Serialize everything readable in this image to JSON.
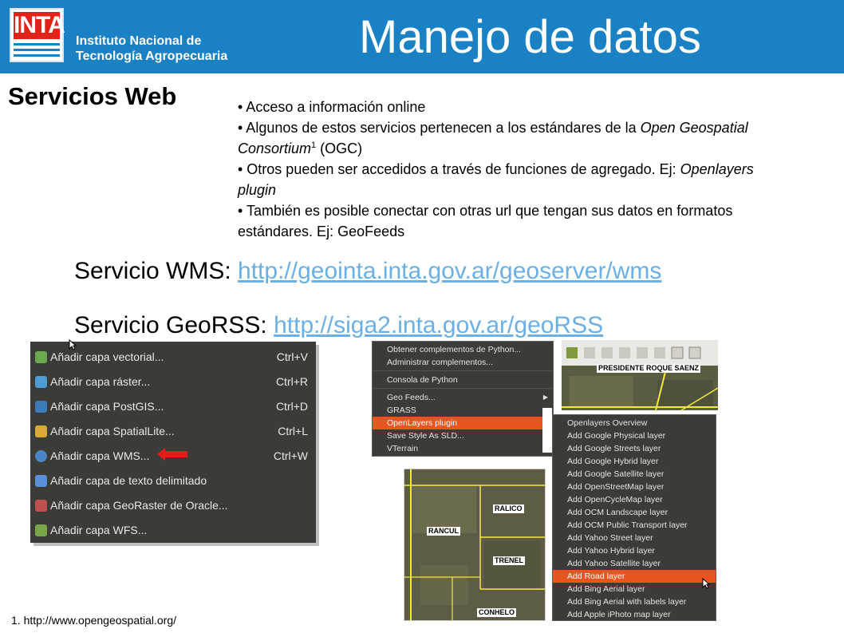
{
  "header": {
    "logo_text": "INTA",
    "org_line1": "Instituto Nacional de",
    "org_line2": "Tecnología Agropecuaria",
    "title": "Manejo de datos"
  },
  "section": {
    "title": "Servicios Web",
    "bullets": {
      "b1": "• Acceso a información online",
      "b2_pre": "• Algunos de estos servicios pertenecen a los estándares de la ",
      "b2_italic": "Open Geospatial Consortium",
      "b2_sup": "1",
      "b2_post": " (OGC)",
      "b3_pre": "• Otros pueden ser accedidos a través de funciones de agregado. Ej: ",
      "b3_italic": "Openlayers plugin",
      "b4": "• También es posible conectar con otras url que tengan sus datos en formatos estándares. Ej: GeoFeeds"
    },
    "wms_label": "Servicio WMS: ",
    "wms_url": "http://geointa.inta.gov.ar/geoserver/wms",
    "georss_label": "Servicio GeoRSS: ",
    "georss_url": "http://siga2.inta.gov.ar/geoRSS"
  },
  "layer_menu": [
    {
      "label": "Añadir capa vectorial...",
      "shortcut": "Ctrl+V"
    },
    {
      "label": "Añadir capa ráster...",
      "shortcut": "Ctrl+R"
    },
    {
      "label": "Añadir capa PostGIS...",
      "shortcut": "Ctrl+D"
    },
    {
      "label": "Añadir capa SpatialLite...",
      "shortcut": "Ctrl+L"
    },
    {
      "label": "Añadir capa WMS...",
      "shortcut": "Ctrl+W"
    },
    {
      "label": "Añadir capa de texto delimitado",
      "shortcut": ""
    },
    {
      "label": "Añadir capa GeoRaster de Oracle...",
      "shortcut": ""
    },
    {
      "label": "Añadir capa WFS...",
      "shortcut": ""
    }
  ],
  "plugin_menu": [
    "Obtener complementos de Python...",
    "Administrar complementos...",
    "Consola de Python",
    "Geo Feeds...",
    "GRASS",
    "OpenLayers plugin",
    "Save Style As SLD...",
    "VTerrain"
  ],
  "openlayers_menu": [
    "Openlayers Overview",
    "Add Google Physical layer",
    "Add Google Streets layer",
    "Add Google Hybrid layer",
    "Add Google Satellite layer",
    "Add OpenStreetMap layer",
    "Add OpenCycleMap layer",
    "Add OCM Landscape layer",
    "Add OCM Public Transport layer",
    "Add Yahoo Street layer",
    "Add Yahoo Hybrid layer",
    "Add Yahoo Satellite layer",
    "Add Road layer",
    "Add Bing Aerial layer",
    "Add Bing Aerial with labels layer",
    "Add Apple iPhoto map layer"
  ],
  "map_labels": {
    "top": "PRESIDENTE ROQUE SAENZ",
    "ralico": "RALICO",
    "rancul": "RANCUL",
    "trenel": "TRENEL",
    "conhelo": "CONHELO"
  },
  "footnote": "1. http://www.opengeospatial.org/",
  "colors": {
    "header_bg": "#1a82c4",
    "logo_red": "#e2231a",
    "link": "#6ab0e6",
    "menu_bg": "#3c3b37",
    "menu_highlight": "#e95420",
    "arrow_red": "#e41b17"
  },
  "icons": {
    "layer_menu_icons": [
      "vector-layer-icon",
      "raster-layer-icon",
      "postgis-layer-icon",
      "spatialite-layer-icon",
      "wms-layer-icon",
      "text-layer-icon",
      "oracle-layer-icon",
      "wfs-layer-icon"
    ]
  }
}
